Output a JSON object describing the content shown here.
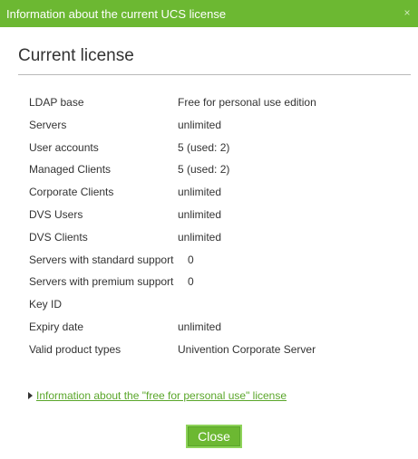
{
  "dialog": {
    "title": "Information about the current UCS license",
    "close_icon": "×",
    "heading": "Current license",
    "rows": [
      {
        "label": "LDAP base",
        "value": "Free for personal use edition"
      },
      {
        "label": "Servers",
        "value": "unlimited"
      },
      {
        "label": "User accounts",
        "value": "5 (used: 2)"
      },
      {
        "label": "Managed Clients",
        "value": "5 (used: 2)"
      },
      {
        "label": "Corporate Clients",
        "value": "unlimited"
      },
      {
        "label": "DVS Users",
        "value": "unlimited"
      },
      {
        "label": "DVS Clients",
        "value": "unlimited"
      },
      {
        "label": "Servers with standard support",
        "value": "0"
      },
      {
        "label": "Servers with premium support",
        "value": "0"
      },
      {
        "label": "Key ID",
        "value": ""
      },
      {
        "label": "Expiry date",
        "value": "unlimited"
      },
      {
        "label": "Valid product types",
        "value": "Univention Corporate Server"
      }
    ],
    "info_link": "Information about the \"free for personal use\" license",
    "close_button": "Close"
  },
  "colors": {
    "accent": "#6cb832",
    "link": "#5aa62a"
  }
}
